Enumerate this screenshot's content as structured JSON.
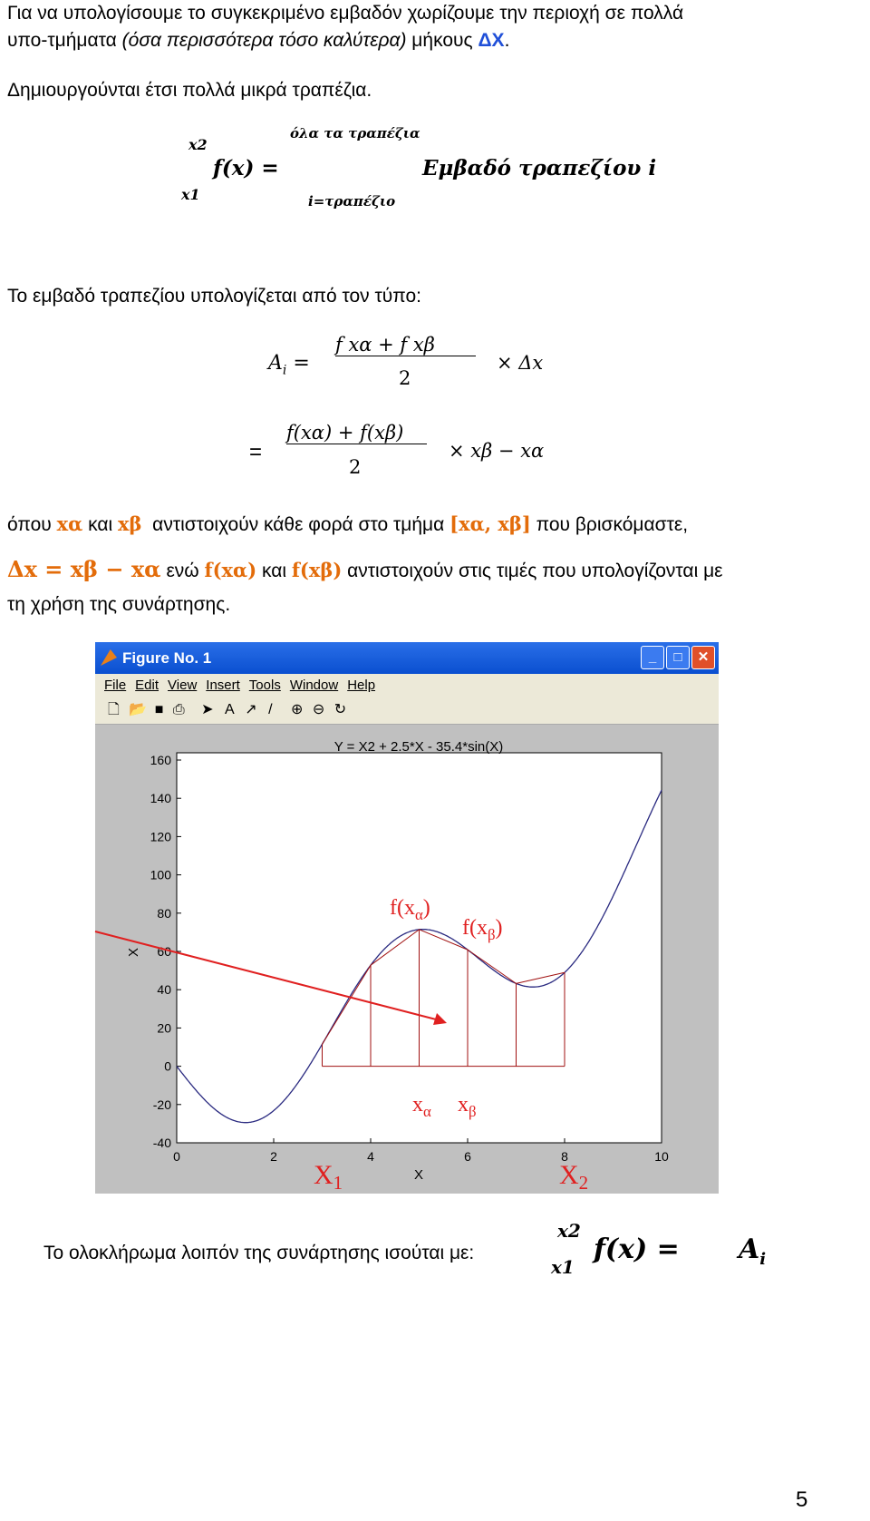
{
  "text": {
    "p1a": "Για να υπολογίσουμε το συγκεκριμένο εμβαδόν χωρίζουμε την περιοχή σε πολλά",
    "p1b_pre": "υπο-τμήματα ",
    "p1b_it": "(όσα περισσότερα τόσο καλύτερα)",
    "p1b_post": " μήκους ",
    "p1b_dx": "ΔΧ",
    "p1b_end": ".",
    "p2": "Δημιουργούνται έτσι πολλά μικρά τραπέζια.",
    "p3": "Το εμβαδό τραπεζίου υπολογίζεται από τον τύπο:",
    "p4": "όπου",
    "p4b": "και",
    "p4c": "αντιστοιχούν κάθε φορά στο τμήμα",
    "p4d": "που βρισκόμαστε,",
    "p5a": "ενώ",
    "p5b": "και",
    "p5c": "αντιστοιχούν στις τιμές που υπολογίζονται με",
    "p6": "τη χρήση της συνάρτησης.",
    "p7": "Το ολοκλήρωμα λοιπόν της συνάρτησης ισούται με:",
    "page_number": "5"
  },
  "formula1": {
    "upper": "x2",
    "lower": "x1",
    "lhs": "f(x) =",
    "sum_top": "όλα τα τραπέζια",
    "sum_bottom": "i=τραπέζιο",
    "rhs": "Εμβαδό τραπεζίου i"
  },
  "formula2": {
    "lhs": "A",
    "lhs_sub": "i",
    "eq": "=",
    "num": "f  xα   + f  xβ",
    "den": "2",
    "times": "× Δx",
    "eq2": "=",
    "num2": "f(xα) + f(xβ)",
    "den2": "2",
    "times2": "×  xβ − xα"
  },
  "inline": {
    "xa": "xα",
    "xb": "xβ",
    "interval": "[xα,  xβ]",
    "dx_eq": "Δx = xβ − xα",
    "fxa": "f(xα)",
    "fxb": "f(xβ)"
  },
  "formula3": {
    "upper": "x2",
    "lower": "x1",
    "lhs": "f(x) =",
    "rhs": "A",
    "rhs_sub": "i"
  },
  "figure": {
    "title": "Figure No. 1",
    "menu": [
      "File",
      "Edit",
      "View",
      "Insert",
      "Tools",
      "Window",
      "Help"
    ],
    "controls": [
      "minimize",
      "maximize",
      "close"
    ],
    "toolbar_icons": [
      "new-icon",
      "open-icon",
      "save-icon",
      "print-icon",
      "arrow-icon",
      "text-icon",
      "line-arrow-icon",
      "line-icon",
      "zoom-in-icon",
      "zoom-out-icon",
      "rotate-icon"
    ]
  },
  "chart_data": {
    "type": "line",
    "title": "Y = X2 + 2.5*X - 35.4*sin(X)",
    "xlabel": "X",
    "ylabel": "X",
    "xlim": [
      0,
      10
    ],
    "ylim": [
      -40,
      160
    ],
    "xticks": [
      0,
      2,
      4,
      6,
      8,
      10
    ],
    "yticks": [
      -40,
      -20,
      0,
      20,
      40,
      60,
      80,
      100,
      120,
      140,
      160
    ],
    "function": "x^2 + 2.5*x - 35.4*sin(x)",
    "trapezoid_x": [
      3,
      4,
      5,
      6,
      7,
      8
    ],
    "annotations": {
      "fxa": "f(xα)",
      "fxb": "f(xβ)",
      "xa": "xα",
      "xb": "xβ",
      "x1": "X1",
      "x2": "X2"
    },
    "colors": {
      "curve": "#2a2a80",
      "trapezoid": "#a01010",
      "annotation": "#e02020"
    }
  }
}
